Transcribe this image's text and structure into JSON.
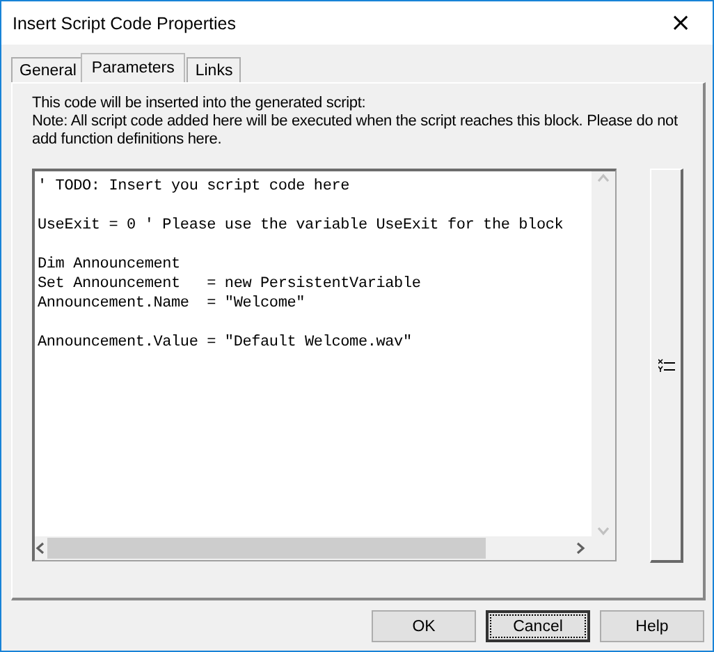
{
  "window": {
    "title": "Insert Script Code Properties",
    "close": "×"
  },
  "tabs": [
    {
      "label": "General",
      "selected": false
    },
    {
      "label": "Parameters",
      "selected": true
    },
    {
      "label": "Links",
      "selected": false
    }
  ],
  "description": [
    "This code will be inserted into the generated script:",
    "Note: All script code added here will be executed when the script reaches this block. Please do not add function definitions here."
  ],
  "code_blocks": [
    [
      "' TODO: Insert you script code here"
    ],
    [
      "UseExit = 0 ' Please use the variable UseExit for the block"
    ],
    [
      "Dim Announcement",
      "Set Announcement   = new PersistentVariable",
      "Announcement.Name  = \"Welcome\""
    ],
    [
      "Announcement.Value = \"Default Welcome.wav\""
    ]
  ],
  "buttons": [
    {
      "label": "OK",
      "focused": false
    },
    {
      "label": "Cancel",
      "focused": true
    },
    {
      "label": "Help",
      "focused": false
    }
  ]
}
